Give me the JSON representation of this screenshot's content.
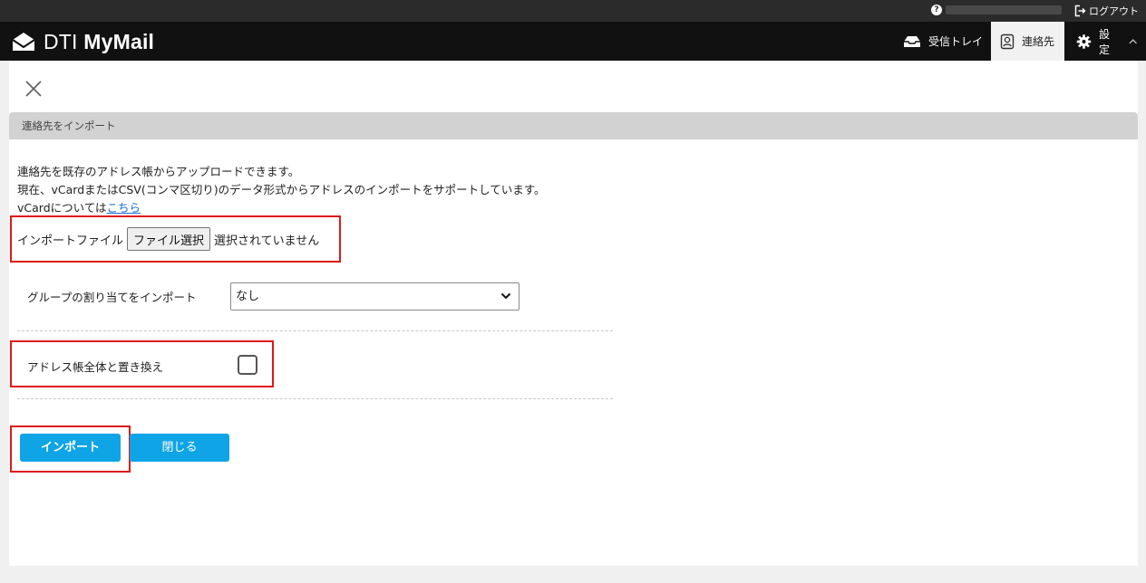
{
  "topbar": {
    "help_icon": "question-circle-icon",
    "logout_icon": "logout-icon",
    "logout_label": "ログアウト"
  },
  "header": {
    "logo_icon": "envelope-open-icon",
    "logo_prefix": "DTI",
    "logo_name": "MyMail",
    "nav": [
      {
        "icon": "inbox-icon",
        "label": "受信トレイ"
      },
      {
        "icon": "contacts-icon",
        "label": "連絡先",
        "active": true
      },
      {
        "icon": "gear-icon",
        "label": "設定"
      }
    ],
    "collapse_icon": "chevron-up-icon"
  },
  "page": {
    "close_icon": "close-icon",
    "section_title": "連絡先をインポート",
    "description": [
      "連絡先を既存のアドレス帳からアップロードできます。",
      "現在、vCardまたはCSV(コンマ区切り)のデータ形式からアドレスのインポートをサポートしています。"
    ],
    "vcard_prefix": "vCardについては",
    "vcard_link": "こちら",
    "file_label": "インポートファイル",
    "file_button": "ファイル選択",
    "file_status": "選択されていません",
    "group_label": "グループの割り当てをインポート",
    "group_value": "なし",
    "replace_label": "アドレス帳全体と置き換え",
    "replace_checked": false,
    "import_button": "インポート",
    "close_button": "閉じる"
  },
  "colors": {
    "header_bg": "#111111",
    "accent": "#0ea4e6",
    "highlight": "#e01818"
  }
}
